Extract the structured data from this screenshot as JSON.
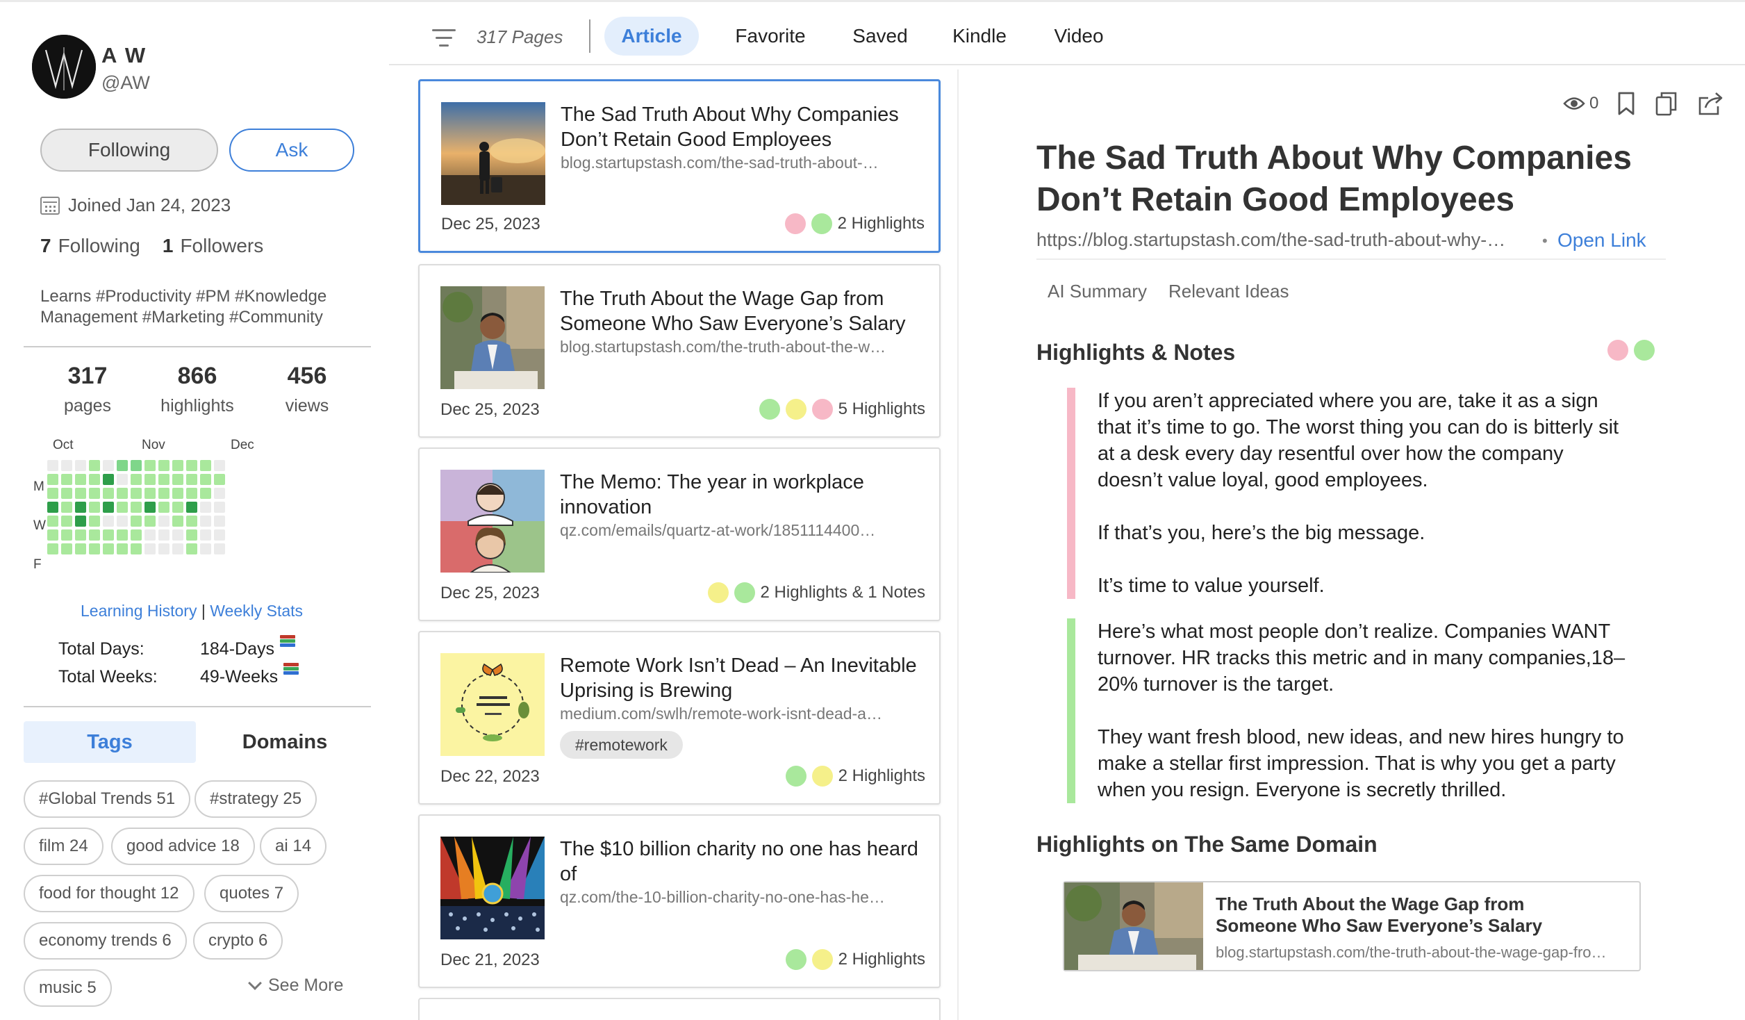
{
  "profile": {
    "name": "A W",
    "handle": "@AW",
    "following_btn": "Following",
    "ask_btn": "Ask",
    "joined": "Joined Jan 24, 2023",
    "following_count": "7",
    "following_label": "Following",
    "followers_count": "1",
    "followers_label": "Followers",
    "bio_line1": "Learns #Productivity #PM #Knowledge",
    "bio_line2": "Management #Marketing #Community"
  },
  "stats": [
    {
      "value": "317",
      "label": "pages"
    },
    {
      "value": "866",
      "label": "highlights"
    },
    {
      "value": "456",
      "label": "views"
    }
  ],
  "heatmap": {
    "months": [
      "Oct",
      "Nov",
      "Dec"
    ],
    "days": [
      "M",
      "W",
      "F"
    ],
    "colors": {
      "0": "#ebebeb",
      "1": "#a9e89c",
      "2": "#7fd68a",
      "3": "#2e9e4a"
    },
    "links": {
      "history": "Learning History",
      "sep": "|",
      "weekly": "Weekly Stats"
    }
  },
  "totals": {
    "days_label": "Total Days:",
    "days_value": "184-Days",
    "weeks_label": "Total Weeks:",
    "weeks_value": "49-Weeks"
  },
  "tabs": {
    "tags": "Tags",
    "domains": "Domains"
  },
  "tags": [
    "#Global Trends 51",
    "#strategy 25",
    "film 24",
    "good advice 18",
    "ai 14",
    "food for thought 12",
    "quotes 7",
    "economy trends 6",
    "crypto 6",
    "music 5"
  ],
  "see_more": "See More",
  "nav": {
    "page_count": "317 Pages",
    "tabs": [
      "Article",
      "Favorite",
      "Saved",
      "Kindle",
      "Video"
    ],
    "active": "Article"
  },
  "articles": [
    {
      "title": "The Sad Truth About Why Companies Don’t Retain Good Employees",
      "url": "blog.startupstash.com/the-sad-truth-about-…",
      "date": "Dec 25, 2023",
      "dots": [
        "pink",
        "green"
      ],
      "highlights": "2 Highlights"
    },
    {
      "title": "The Truth About the Wage Gap from Someone Who Saw Everyone’s Salary",
      "url": "blog.startupstash.com/the-truth-about-the-w…",
      "date": "Dec 25, 2023",
      "dots": [
        "green",
        "yellow",
        "pink"
      ],
      "highlights": "5 Highlights"
    },
    {
      "title": "The Memo: The year in workplace innovation",
      "url": "qz.com/emails/quartz-at-work/1851114400…",
      "date": "Dec 25, 2023",
      "dots": [
        "yellow",
        "green"
      ],
      "highlights": "2 Highlights & 1 Notes"
    },
    {
      "title": "Remote Work Isn’t Dead – An Inevitable Uprising is Brewing",
      "url": "medium.com/swlh/remote-work-isnt-dead-a…",
      "tag": "#remotework",
      "date": "Dec 22, 2023",
      "dots": [
        "green",
        "yellow"
      ],
      "highlights": "2 Highlights"
    },
    {
      "title": "The $10 billion charity no one has heard of",
      "url": "qz.com/the-10-billion-charity-no-one-has-he…",
      "date": "Dec 21, 2023",
      "dots": [
        "green",
        "yellow"
      ],
      "highlights": "2 Highlights"
    }
  ],
  "detail": {
    "views": "0",
    "title": "The Sad Truth About Why Companies Don’t Retain Good Employees",
    "url": "https://blog.startupstash.com/the-sad-truth-about-why-…",
    "bullet": "•",
    "open_link": "Open Link",
    "subtabs": [
      "AI Summary",
      "Relevant Ideas"
    ],
    "highlights_heading": "Highlights & Notes",
    "highlight1": [
      "If you aren’t appreciated where you are, take it as a sign that it’s time to go. The worst thing you can do is bitterly sit at a desk every day resentful over how the company doesn’t value loyal, good employees.",
      "If that’s you, here’s the big message.",
      "It’s time to value yourself."
    ],
    "highlight2": [
      "Here’s what most people don’t realize. Companies WANT turnover. HR tracks this metric and in many companies,18–20% turnover is the target.",
      "They want fresh blood, new ideas, and new hires hungry to make a stellar first impression. That is why you get a party when you resign. Everyone is secretly thrilled."
    ],
    "same_domain_heading": "Highlights on The Same Domain",
    "related": {
      "title": "The Truth About the Wage Gap from Someone Who Saw Everyone’s Salary",
      "url": "blog.startupstash.com/the-truth-about-the-wage-gap-fro…"
    }
  }
}
